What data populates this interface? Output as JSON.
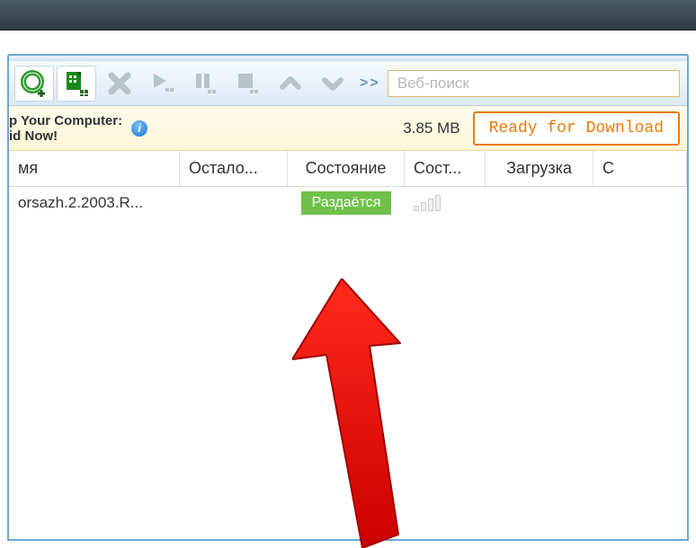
{
  "titlebar": {},
  "toolbar": {
    "overflow_label": ">>",
    "search_placeholder": "Веб-поиск"
  },
  "update_bar": {
    "line1": "p Your Computer:",
    "line2": "id Now!",
    "info_icon": "info-icon",
    "size": "3.85 MB",
    "ready_label": "Ready for Download"
  },
  "columns": {
    "name": "мя",
    "remain": "Остало...",
    "state": "Состояние",
    "sost": "Сост...",
    "download": "Загрузка",
    "last": "C"
  },
  "rows": [
    {
      "name": "orsazh.2.2003.R...",
      "state_label": "Раздаётся"
    }
  ]
}
